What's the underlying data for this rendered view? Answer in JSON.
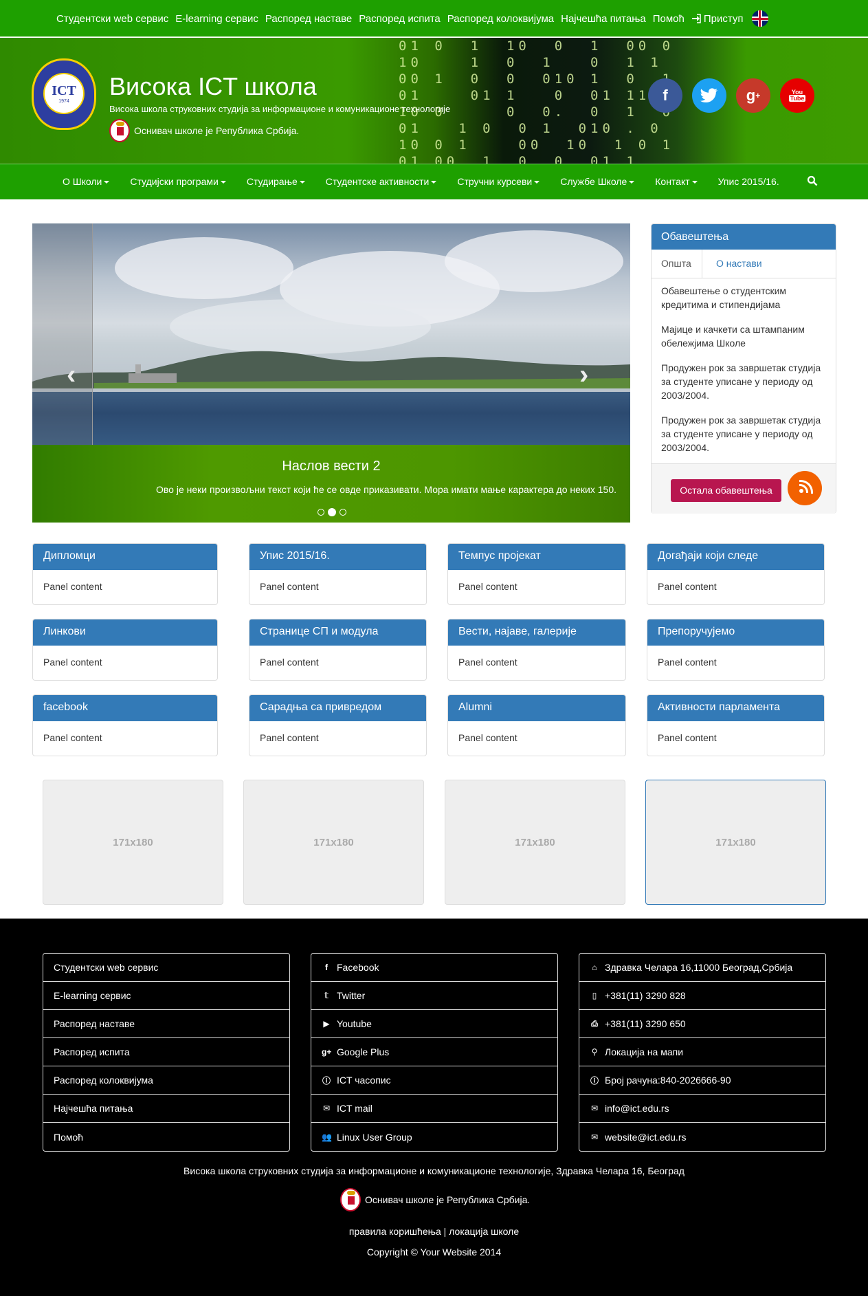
{
  "topbar": {
    "links": [
      "Студентски web сервис",
      "E-learning сервис",
      "Распоред наставе",
      "Распоред испита",
      "Распоред колоквијума",
      "Најчешћа питања",
      "Помоћ"
    ],
    "login": "Приступ",
    "login_icon": "sign-in-icon",
    "language_icon": "uk-flag-icon"
  },
  "header": {
    "logo_text": "ICT",
    "logo_year": "1974",
    "title": "Висока ICT школа",
    "subtitle": "Висока школа струковних студија за информационе и комуникационе технологије",
    "founder": "Оснивач школе је Република Србија.",
    "social": [
      "facebook-icon",
      "twitter-icon",
      "google-plus-icon",
      "youtube-icon"
    ]
  },
  "nav": {
    "items": [
      "О Школи",
      "Студијски програми",
      "Студирање",
      "Студентске активности",
      "Стручни курсеви",
      "Службе Школе",
      "Контакт",
      "Упис 2015/16."
    ],
    "search_icon": "search-icon"
  },
  "carousel": {
    "title": "Наслов вести 2",
    "text": "Ово је неки произвољни текст који ће се овде приказивати. Мора имати мање карактера до неких 150.",
    "slides": 3,
    "active_slide": 2
  },
  "notices": {
    "title": "Обавештења",
    "tabs": [
      "Општа",
      "О настави"
    ],
    "items": [
      "Обавештење о студентским кредитима и стипендијама",
      "Мајице и качкети са штампаним обележјима Школе",
      "Продужен рок за завршетак студија за студенте уписане у периоду од 2003/2004.",
      "Продужен рок за завршетак студија за студенте уписане у периоду од 2003/2004."
    ],
    "more_button": "Остала обавештења",
    "rss_icon": "rss-icon"
  },
  "panels": [
    {
      "title": "Дипломци",
      "content": "Panel content"
    },
    {
      "title": "Упис 2015/16.",
      "content": "Panel content"
    },
    {
      "title": "Темпус пројекат",
      "content": "Panel content"
    },
    {
      "title": "Догађаји који следе",
      "content": "Panel content"
    },
    {
      "title": "Линкови",
      "content": "Panel content"
    },
    {
      "title": "Странице СП и модула",
      "content": "Panel content"
    },
    {
      "title": "Вести, најаве, галерије",
      "content": "Panel content"
    },
    {
      "title": "Препоручујемо",
      "content": "Panel content"
    },
    {
      "title": "facebook",
      "content": "Panel content"
    },
    {
      "title": "Сарадња са привредом",
      "content": "Panel content"
    },
    {
      "title": "Alumni",
      "content": "Panel content"
    },
    {
      "title": "Активности парламента",
      "content": "Panel content"
    }
  ],
  "thumbnails": [
    "171x180",
    "171x180",
    "171x180",
    "171x180"
  ],
  "footer": {
    "links": [
      "Студентски web сервис",
      "E-learning сервис",
      "Распоред наставе",
      "Распоред испита",
      "Распоред колоквијума",
      "Најчешћа питања",
      "Помоћ"
    ],
    "social": [
      {
        "label": "Facebook",
        "icon": "facebook-icon"
      },
      {
        "label": "Twitter",
        "icon": "twitter-icon"
      },
      {
        "label": "Youtube",
        "icon": "youtube-icon"
      },
      {
        "label": "Google Plus",
        "icon": "google-plus-icon"
      },
      {
        "label": "ICT часопис",
        "icon": "info-icon"
      },
      {
        "label": "ICT mail",
        "icon": "envelope-icon"
      },
      {
        "label": "Linux User Group",
        "icon": "users-icon"
      }
    ],
    "contact": [
      {
        "label": "Здравка Челара 16,11000 Београд,Србија",
        "icon": "home-icon"
      },
      {
        "label": "+381(11) 3290 828",
        "icon": "phone-icon"
      },
      {
        "label": "+381(11) 3290 650",
        "icon": "print-icon"
      },
      {
        "label": "Локација на мапи",
        "icon": "map-marker-icon"
      },
      {
        "label": "Број рачуна:840-2026666-90",
        "icon": "info-icon"
      },
      {
        "label": "info@ict.edu.rs",
        "icon": "envelope-icon"
      },
      {
        "label": "website@ict.edu.rs",
        "icon": "envelope-icon"
      }
    ],
    "address_line": "Висока школа струковних студија за информационе и комуникационе технологије, Здравка Челара 16, Београд",
    "founder": "Оснивач школе је Република Србија.",
    "rules": "правила коришћења",
    "separator": "|",
    "location": "локација школе",
    "copyright": "Copyright © Your Website 2014"
  }
}
